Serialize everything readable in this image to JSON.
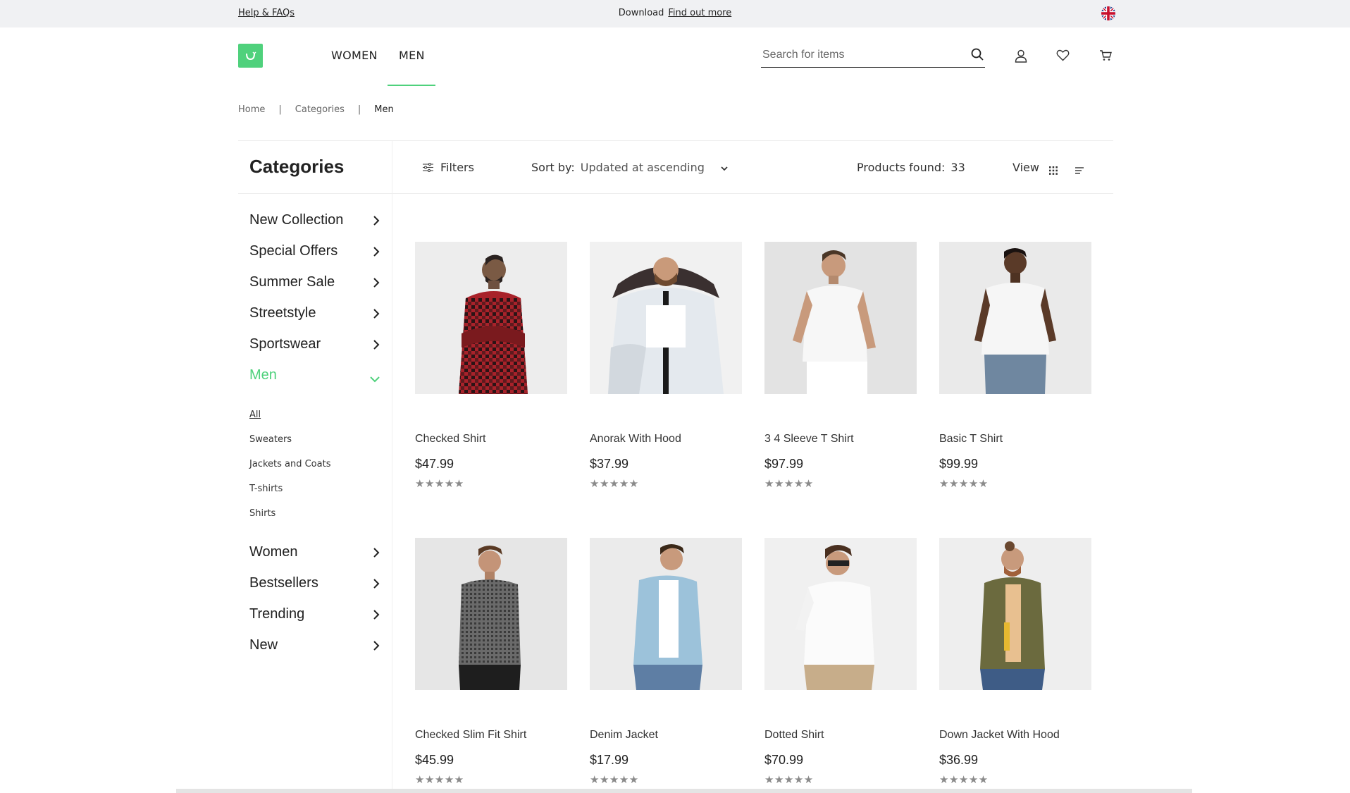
{
  "topbar": {
    "help_label": "Help & FAQs",
    "download_label": "Download",
    "find_out_label": "Find out more",
    "flag_icon": "uk-flag-icon"
  },
  "header": {
    "nav": [
      "WOMEN",
      "MEN"
    ],
    "search_placeholder": "Search for items",
    "accent_color": "#4fd17c"
  },
  "breadcrumb": {
    "items": [
      "Home",
      "Categories",
      "Men"
    ],
    "separator": "|"
  },
  "sidebar": {
    "title": "Categories",
    "items": [
      {
        "label": "New Collection"
      },
      {
        "label": "Special Offers"
      },
      {
        "label": "Summer Sale"
      },
      {
        "label": "Streetstyle"
      },
      {
        "label": "Sportswear"
      },
      {
        "label": "Men"
      },
      {
        "label": "Women"
      },
      {
        "label": "Bestsellers"
      },
      {
        "label": "Trending"
      },
      {
        "label": "New"
      }
    ],
    "subitems": [
      "All",
      "Sweaters",
      "Jackets and Coats",
      "T-shirts",
      "Shirts"
    ]
  },
  "toolbar": {
    "filters_label": "Filters",
    "sort_label": "Sort by:",
    "sort_value": "Updated at ascending",
    "found_label": "Products found:",
    "found_count": "33",
    "view_label": "View"
  },
  "products": [
    {
      "name": "Checked Shirt",
      "price": "$47.99",
      "stars": "★★★★★"
    },
    {
      "name": "Anorak With Hood",
      "price": "$37.99",
      "stars": "★★★★★"
    },
    {
      "name": "3 4 Sleeve T Shirt",
      "price": "$97.99",
      "stars": "★★★★★"
    },
    {
      "name": "Basic T Shirt",
      "price": "$99.99",
      "stars": "★★★★★"
    },
    {
      "name": "Checked Slim Fit Shirt",
      "price": "$45.99",
      "stars": "★★★★★"
    },
    {
      "name": "Denim Jacket",
      "price": "$17.99",
      "stars": "★★★★★"
    },
    {
      "name": "Dotted Shirt",
      "price": "$70.99",
      "stars": "★★★★★"
    },
    {
      "name": "Down Jacket With Hood",
      "price": "$36.99",
      "stars": "★★★★★"
    }
  ]
}
